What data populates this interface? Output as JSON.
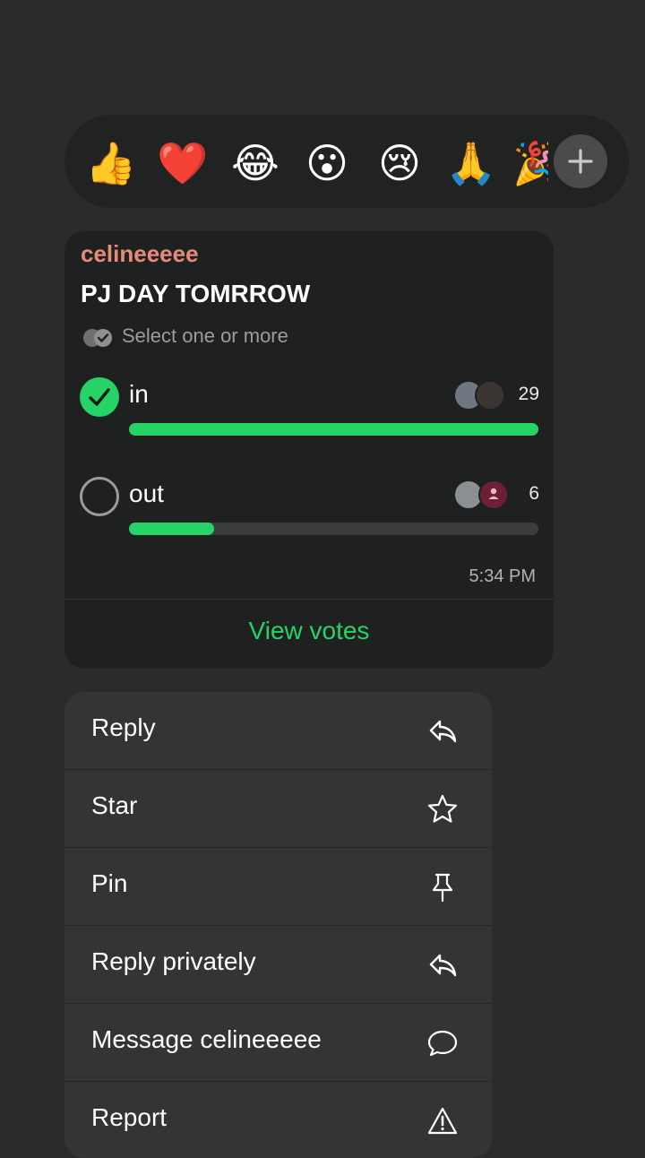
{
  "reactions": {
    "emojis": [
      {
        "name": "thumbs-up-emoji",
        "glyph": "👍"
      },
      {
        "name": "red-heart-emoji",
        "glyph": "❤️"
      },
      {
        "name": "laughing-tears-emoji",
        "glyph": "😂"
      },
      {
        "name": "surprised-emoji",
        "glyph": "😮"
      },
      {
        "name": "crying-emoji",
        "glyph": "😢"
      },
      {
        "name": "praying-hands-emoji",
        "glyph": "🙏"
      },
      {
        "name": "party-popper-emoji",
        "glyph": "🎉"
      }
    ],
    "more_icon": "plus-icon"
  },
  "poll": {
    "sender": "celineeeee",
    "question": "PJ DAY TOMRROW",
    "hint": "Select one or more",
    "options": [
      {
        "label": "in",
        "count": "29",
        "fraction": 1.0,
        "selected": true
      },
      {
        "label": "out",
        "count": "6",
        "fraction": 0.207,
        "selected": false
      }
    ],
    "time": "5:34 PM",
    "view_votes": "View votes"
  },
  "menu": {
    "items": [
      {
        "label": "Reply",
        "icon": "reply-icon"
      },
      {
        "label": "Star",
        "icon": "star-icon"
      },
      {
        "label": "Pin",
        "icon": "pin-icon"
      },
      {
        "label": "Reply privately",
        "icon": "reply-privately-icon"
      },
      {
        "label": "Message celineeeee",
        "icon": "message-bubble-icon"
      },
      {
        "label": "Report",
        "icon": "warning-icon"
      }
    ]
  },
  "colors": {
    "background": "#2a2b2b",
    "card": "#1f2121",
    "menu": "#333434",
    "accent_green": "#25d366",
    "sender_color": "#e8897a"
  }
}
